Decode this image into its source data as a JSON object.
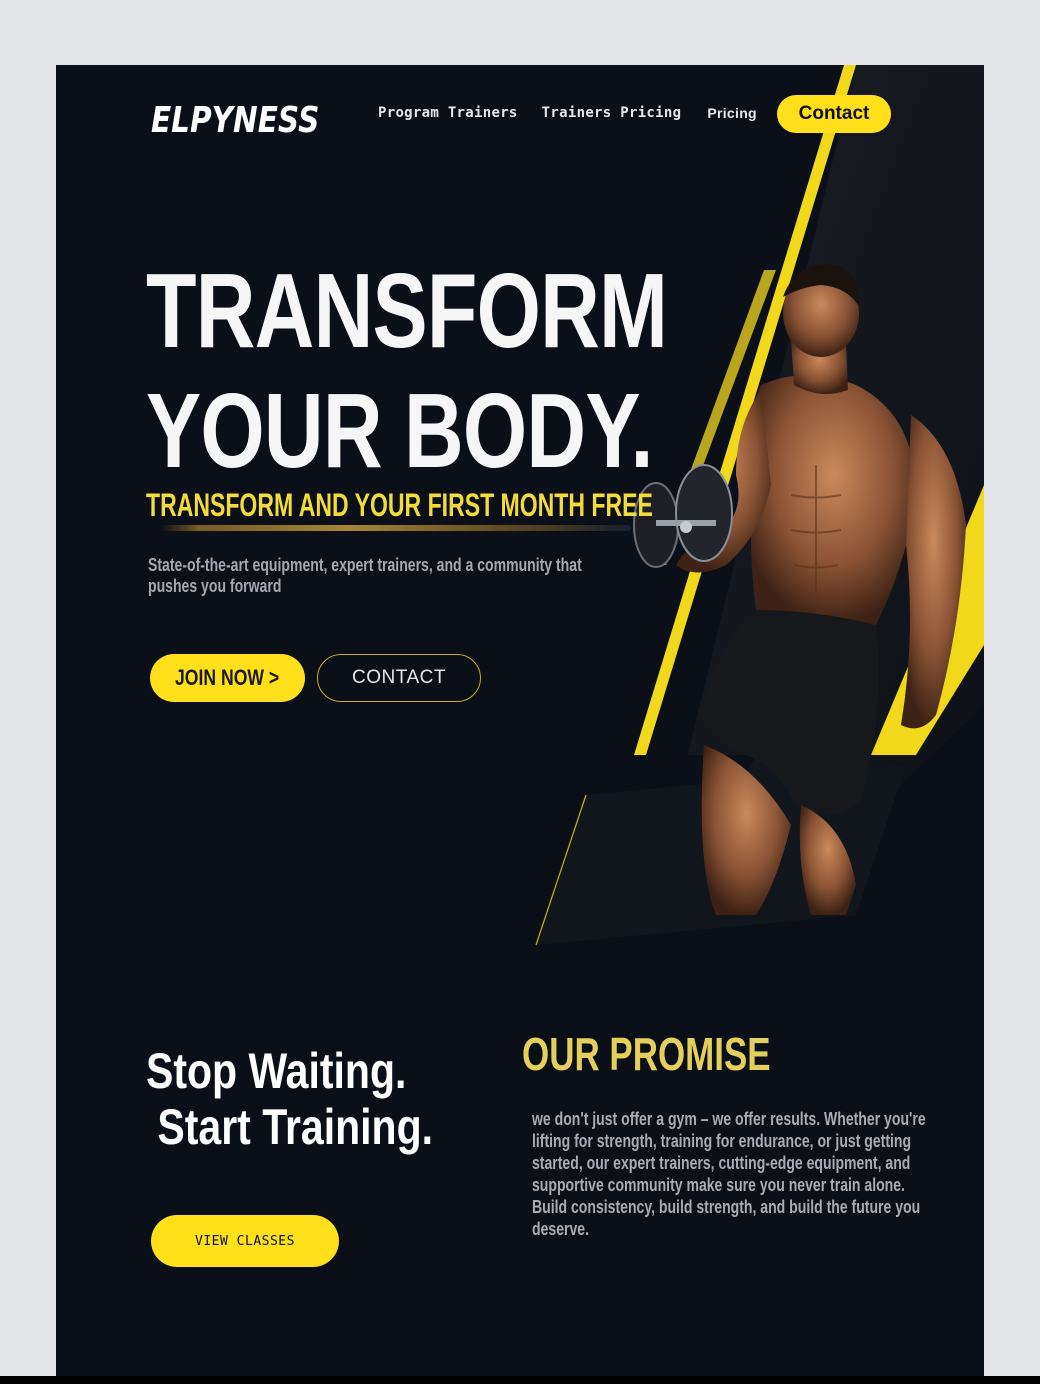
{
  "brand": {
    "logo": "ELPYNESS",
    "accent": "#ffe01b",
    "background": "#0b0f17"
  },
  "nav": {
    "items": [
      "Program Trainers",
      "Trainers Pricing",
      "Pricing"
    ],
    "contact_label": "Contact"
  },
  "hero": {
    "title_line1": "TRANSFORM",
    "title_line2": "YOUR BODY.",
    "subtitle": "TRANSFORM AND YOUR FIRST MONTH FREE",
    "description": "State-of-the-art equipment, expert trainers, and a community that pushes you forward",
    "join_label": "JOIN NOW >",
    "contact_label": "CONTACT"
  },
  "section2": {
    "left_title": "Stop Waiting.\n Start Training.",
    "classes_label": "VIEW CLASSES",
    "promise_title": "OUR PROMISE",
    "promise_text": "we don't just offer a gym – we offer results. Whether you're lifting for strength, training for endurance, or just getting started, our expert trainers, cutting-edge equipment, and supportive community make sure you never train alone. Build consistency, build strength, and build the future you deserve."
  }
}
